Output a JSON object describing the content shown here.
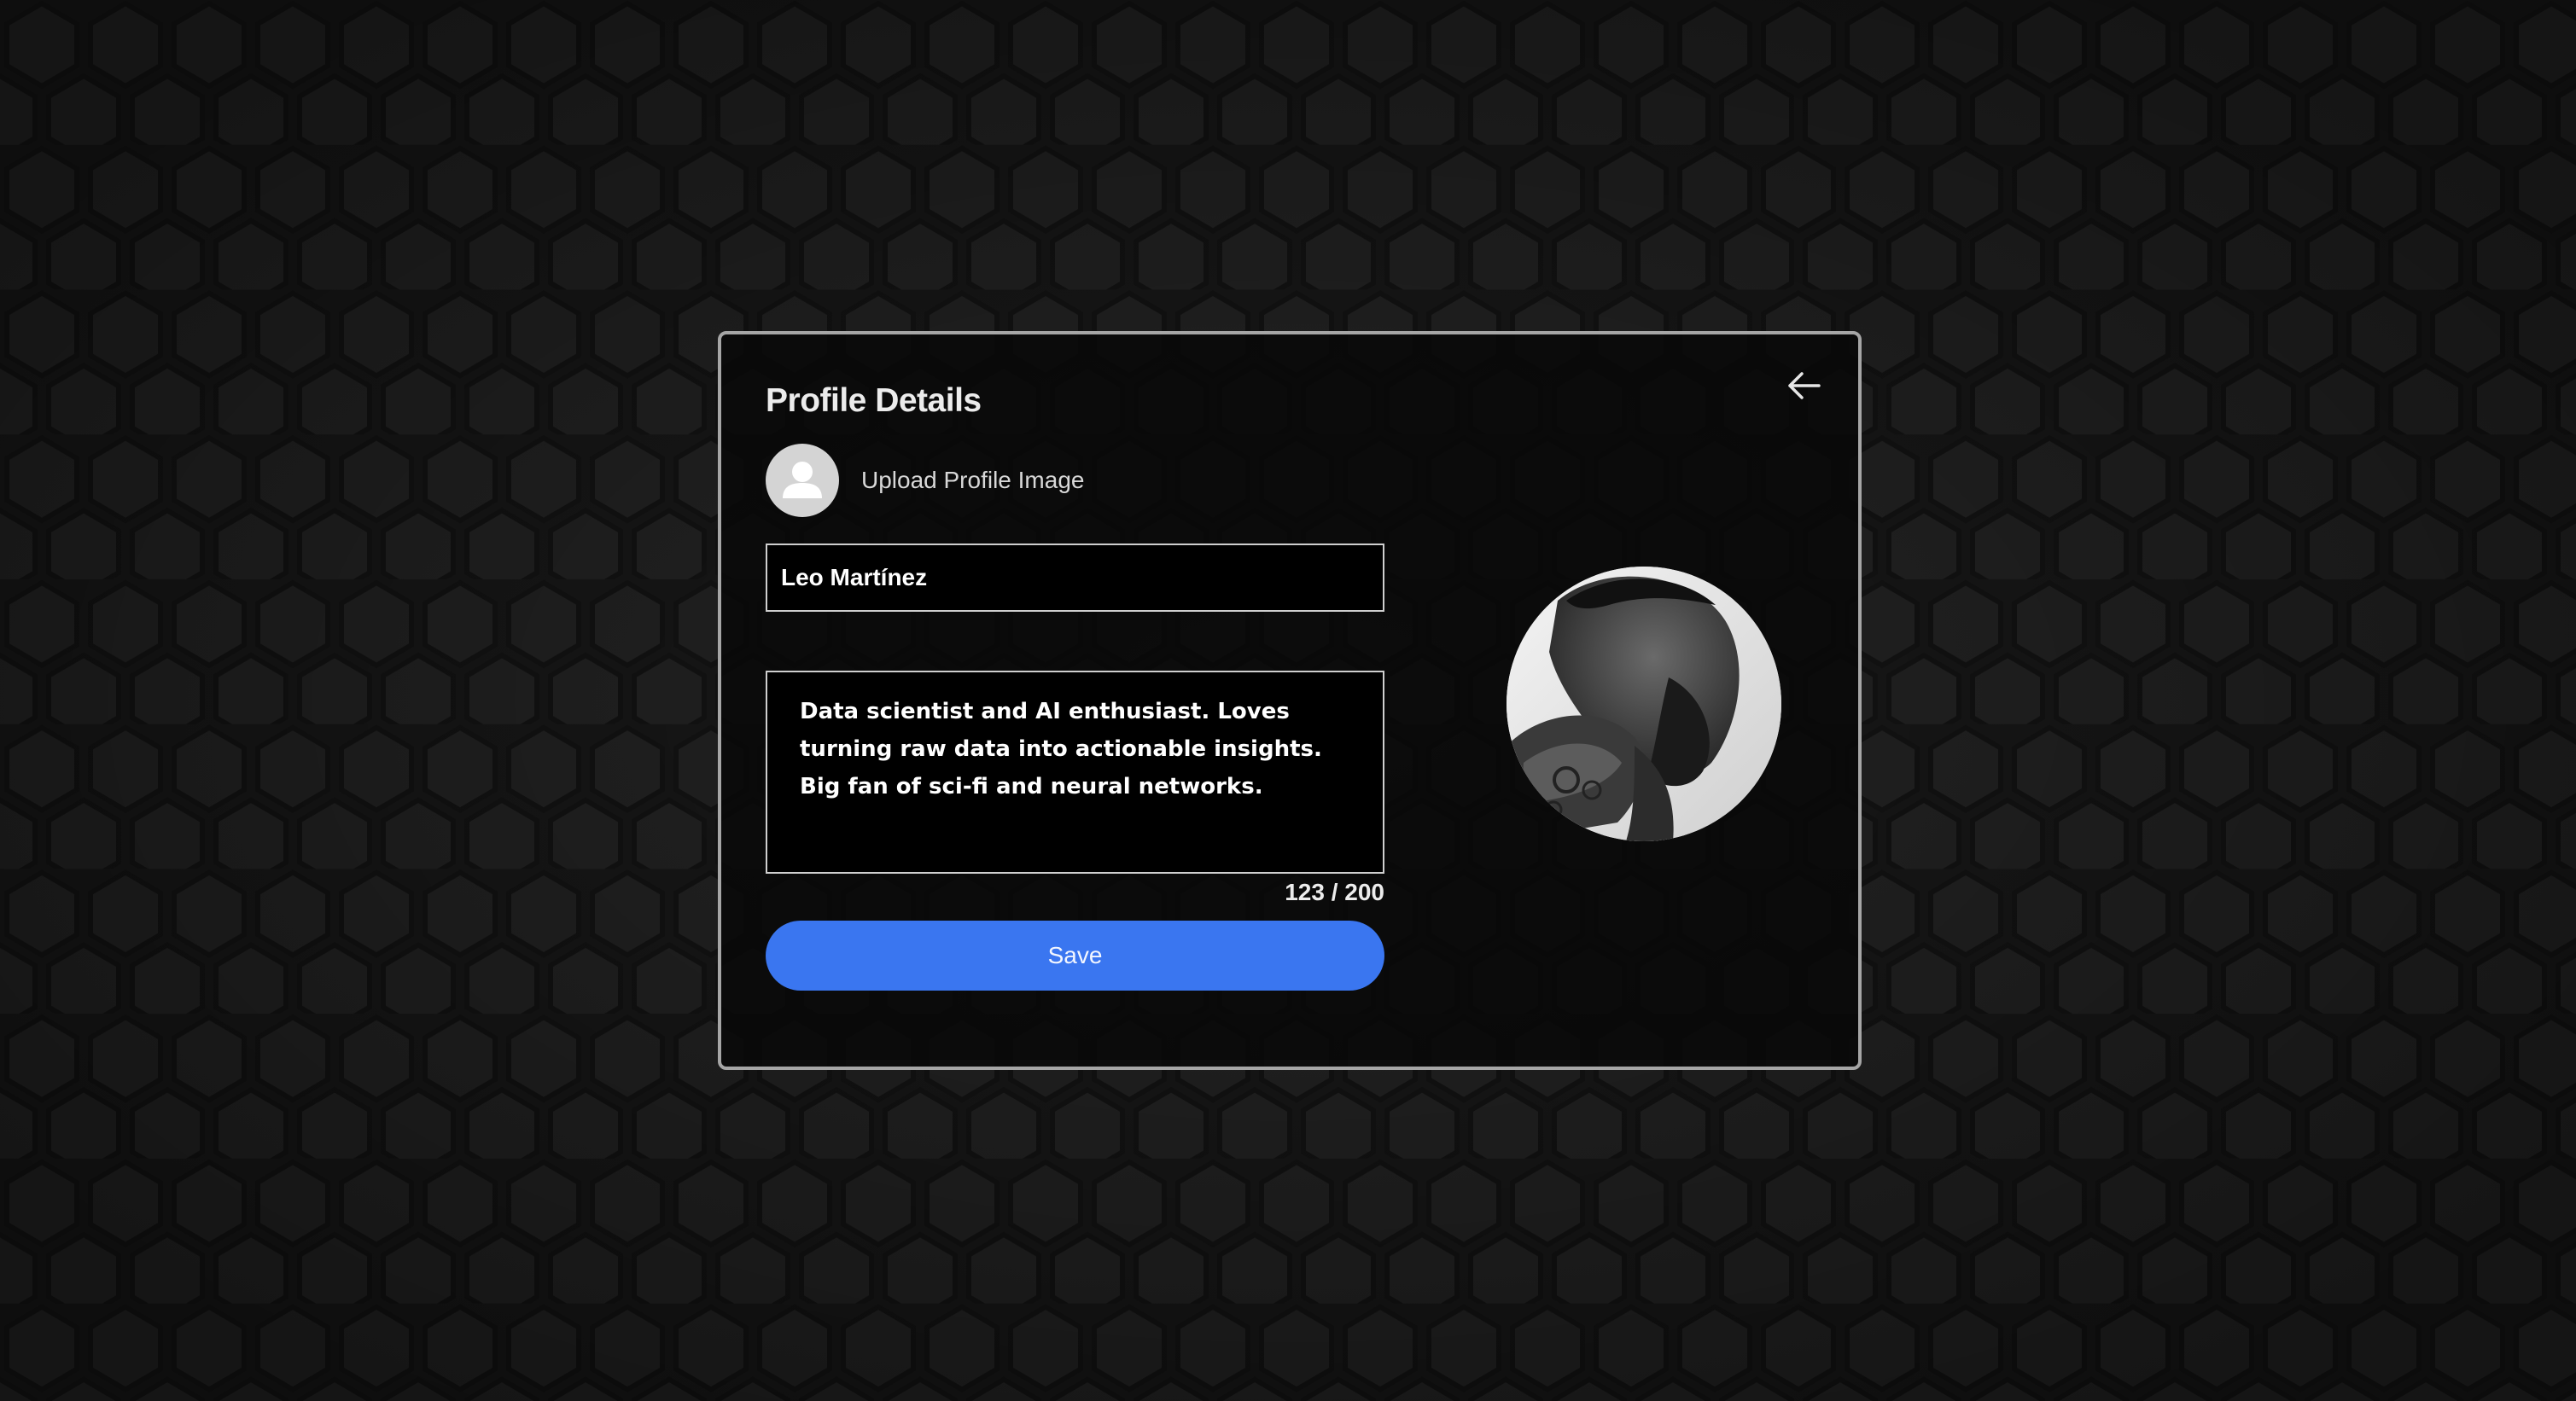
{
  "page": {
    "title": "Profile Details"
  },
  "header": {
    "back_icon": "arrow-left-icon"
  },
  "upload": {
    "label": "Upload Profile Image",
    "icon": "user-placeholder-icon"
  },
  "form": {
    "name_value": "Leo Martínez",
    "bio_value": "Data scientist and AI enthusiast. Loves turning raw data into actionable insights. Big fan of sci-fi and neural networks.",
    "char_count": "123 / 200",
    "save_label": "Save"
  },
  "colors": {
    "accent": "#3a76f0",
    "background": "#1b1b1b",
    "panel": "#080808",
    "border": "#a6a6a6"
  }
}
